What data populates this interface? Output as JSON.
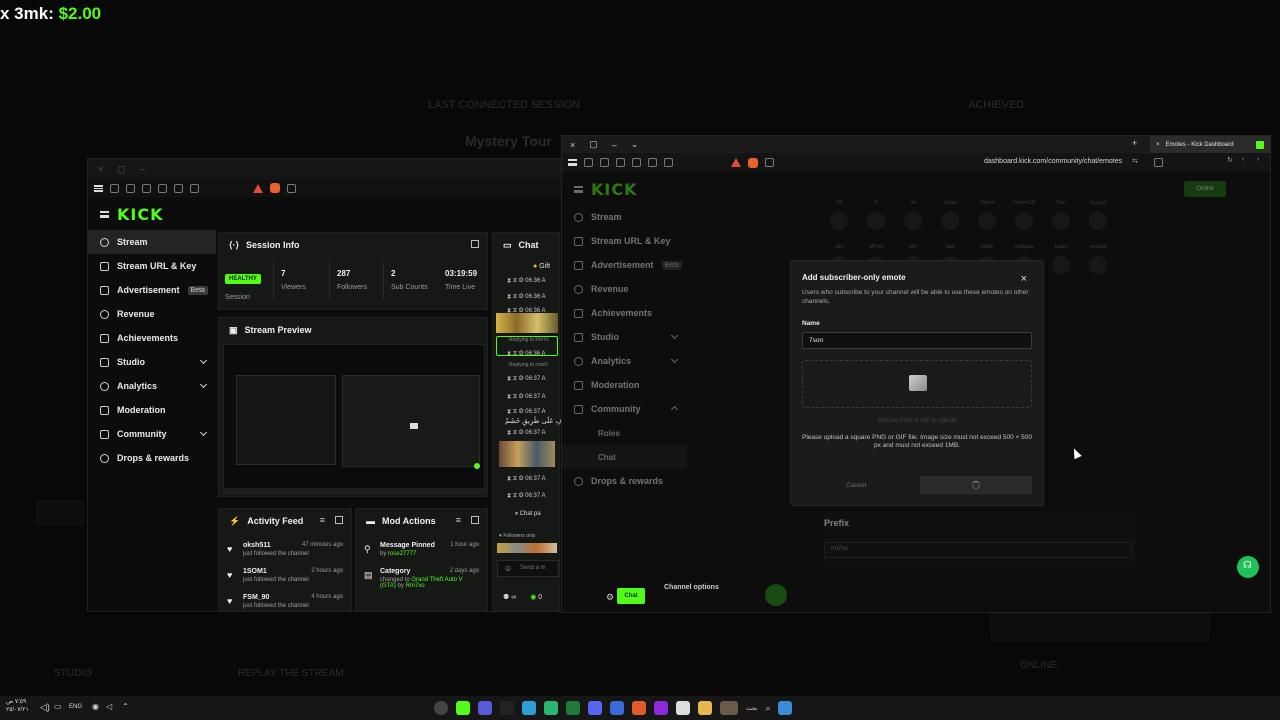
{
  "overlay": {
    "prefix": "x 3mk: ",
    "amount": "$2.00"
  },
  "left_window": {
    "logo": "KICK",
    "nav": [
      {
        "label": "Stream",
        "active": true
      },
      {
        "label": "Stream URL & Key"
      },
      {
        "label": "Advertisement",
        "badge": "Beta"
      },
      {
        "label": "Revenue"
      },
      {
        "label": "Achievements"
      },
      {
        "label": "Studio",
        "chevron": true
      },
      {
        "label": "Analytics",
        "chevron": true
      },
      {
        "label": "Moderation"
      },
      {
        "label": "Community",
        "chevron": true
      },
      {
        "label": "Drops & rewards"
      }
    ],
    "session": {
      "title": "Session Info",
      "status": "HEALTHY",
      "status_label": "Session",
      "stats": [
        {
          "value": "7",
          "label": "Viewers"
        },
        {
          "value": "287",
          "label": "Followers"
        },
        {
          "value": "2",
          "label": "Sub Counts"
        },
        {
          "value": "03:19:59",
          "label": "Time Live"
        }
      ]
    },
    "preview": {
      "title": "Stream Preview"
    },
    "activity": {
      "title": "Activity Feed",
      "items": [
        {
          "name": "oksh511",
          "sub": "just followed the channel",
          "time": "47 minutes ago"
        },
        {
          "name": "1SOM1",
          "sub": "just followed the channel",
          "time": "2 hours ago"
        },
        {
          "name": "FSM_90",
          "sub": "just followed the channel",
          "time": "4 hours ago"
        }
      ]
    },
    "mod": {
      "title": "Mod Actions",
      "items": [
        {
          "name": "Message Pinned",
          "sub_pre": "by ",
          "sub_user": "rose27777",
          "time": "1 hour ago"
        },
        {
          "name": "Category",
          "sub_pre": "changed to ",
          "sub_user": "Grand Theft Auto V (GTA)",
          "sub_by": " by ",
          "sub_by_user": "Rm7xo",
          "time": "2 days ago"
        }
      ]
    },
    "chat": {
      "title": "Chat",
      "gift": "Gift",
      "times": [
        "06:36 A",
        "06:36 A",
        "06:36 A",
        "06:36 A",
        "06:37 A",
        "06:37 A",
        "06:37 A",
        "06:37 A",
        "06:37 A",
        "06:37 A"
      ],
      "replying1": "Replying to Rm7x",
      "replying2": "Replying to rose2",
      "arabic": "زَخْرُفِ عَلَى طَرِيقِ خَشَمْ",
      "paused": "Chat pa",
      "followers_only": "Followers only",
      "send_placeholder": "Send a m",
      "viewers": "0",
      "button": "Chat"
    }
  },
  "right_window": {
    "tab_title": "Emotes - Kick Dashboard",
    "url": "dashboard.kick.com/community/chat/emotes",
    "logo": "KICK",
    "nav": [
      {
        "label": "Stream"
      },
      {
        "label": "Stream URL & Key"
      },
      {
        "label": "Advertisement",
        "badge": "Beta"
      },
      {
        "label": "Revenue"
      },
      {
        "label": "Achievements"
      },
      {
        "label": "Studio",
        "chevron": true
      },
      {
        "label": "Analytics",
        "chevron": true
      },
      {
        "label": "Moderation"
      },
      {
        "label": "Community",
        "chevron_up": true
      }
    ],
    "sub_nav": [
      {
        "label": "Roles"
      },
      {
        "label": "Chat",
        "active": true
      }
    ],
    "nav_after": [
      {
        "label": "Drops & rewards"
      }
    ],
    "prefix_label": "Prefix",
    "prefix_value": "rm7xo",
    "channel_options": "Channel options",
    "online_label": "Online",
    "emote_labels": [
      "12",
      "3",
      "3a",
      "7asyn",
      "7mmm",
      "7mmm23l",
      "7ryn",
      "7yyyyyy",
      "alm",
      "aff7ao",
      "alm",
      "bad",
      "battle",
      "catApple",
      "kaam",
      "ramadh",
      "mhadt",
      "mbsy",
      "wiw",
      "wea"
    ]
  },
  "modal": {
    "title": "Add subscriber-only emote",
    "description": "Users who subscribe to your channel will be able to use these emotes on other channels.",
    "name_label": "Name",
    "name_value": "7son",
    "drop_hint": "Choose PNG & GIF to upload",
    "help": "Please upload a square PNG or GIF file. Image size must not exceed 500 × 500 px and must not exceed 1MB.",
    "cancel": "Cancel"
  },
  "background": {
    "section_title": "LAST CONNECTED SESSION",
    "stream_title": "Mystery Tour",
    "achieved": "ACHIEVED",
    "online": "ONLINE",
    "studio_label": "STUDIO",
    "replay_label": "REPLAY THE STREAM"
  },
  "taskbar": {
    "time": "٧:٥٩ ص",
    "date": "٢٥/٠٧/٢١",
    "lang": "ENG",
    "search": "بحث"
  },
  "colors": {
    "accent": "#53fc18",
    "panel": "#161816",
    "bg": "#070807"
  }
}
